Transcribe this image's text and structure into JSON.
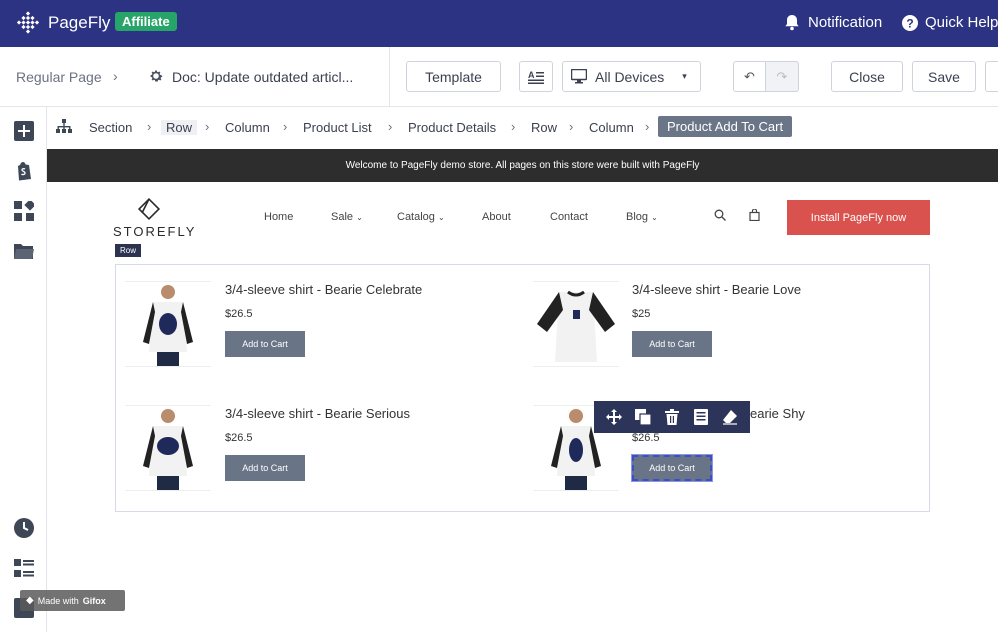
{
  "topbar": {
    "brand": "PageFly",
    "badge": "Affiliate",
    "notification": "Notification",
    "help": "Quick Help"
  },
  "toolbar": {
    "breadcrumb_root": "Regular Page",
    "page_title": "Doc: Update outdated articl...",
    "template_label": "Template",
    "devices_label": "All Devices",
    "close_label": "Close",
    "save_label": "Save"
  },
  "breadcrumb": [
    "Section",
    "Row",
    "Column",
    "Product List",
    "Product Details",
    "Row",
    "Column"
  ],
  "breadcrumb_active": "Product Add To Cart",
  "store": {
    "announcement": "Welcome to PageFly demo store. All pages on this store were built with PageFly",
    "name": "STOREFLY",
    "nav": [
      "Home",
      "Sale",
      "Catalog",
      "About",
      "Contact",
      "Blog"
    ],
    "install_label": "Install PageFly now",
    "row_tag": "Row"
  },
  "products": [
    {
      "name": "3/4-sleeve shirt - Bearie Celebrate",
      "price": "$26.5",
      "button": "Add to Cart"
    },
    {
      "name": "3/4-sleeve shirt - Bearie Love",
      "price": "$25",
      "button": "Add to Cart"
    },
    {
      "name": "3/4-sleeve shirt - Bearie Serious",
      "price": "$26.5",
      "button": "Add to Cart"
    },
    {
      "name": "earie Shy",
      "price": "$26.5",
      "button": "Add to Cart"
    }
  ],
  "watermark": {
    "prefix": "Made with",
    "brand": "Gifox"
  },
  "colors": {
    "topbar": "#2c3382",
    "badge": "#27a468",
    "install": "#d9524d",
    "button": "#697587",
    "element_toolbar": "#2d3459"
  }
}
